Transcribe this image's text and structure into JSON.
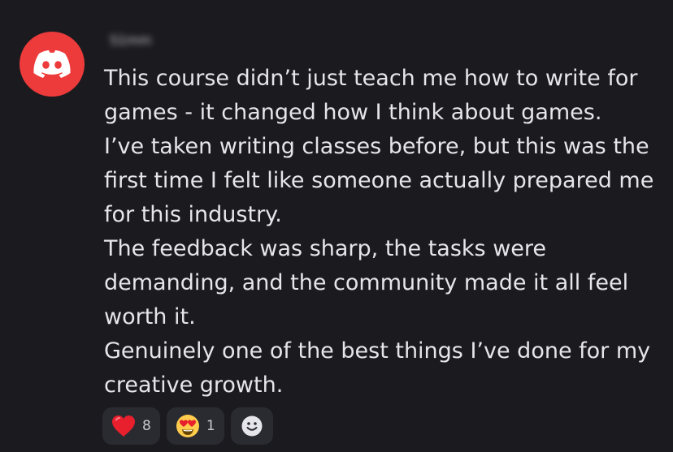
{
  "author": {
    "avatar_icon": "discord-logo-icon",
    "avatar_color": "#ed3b3b",
    "username": "S1mm"
  },
  "message": {
    "lines": [
      "This course didn’t just teach me how to write for",
      "games - it changed how I think about games.",
      "I’ve taken writing classes before, but this was the",
      "first time I felt like someone actually prepared me",
      "for this industry.",
      "The feedback was sharp, the tasks were",
      "demanding, and the community made it all feel",
      "worth it.",
      "Genuinely one of the best things I’ve done for my",
      "creative growth."
    ]
  },
  "reactions": [
    {
      "icon": "red-heart-icon",
      "count": "8"
    },
    {
      "icon": "heart-eyes-face-icon",
      "count": "1"
    }
  ],
  "add_reaction": {
    "icon": "add-reaction-smiley-icon"
  }
}
